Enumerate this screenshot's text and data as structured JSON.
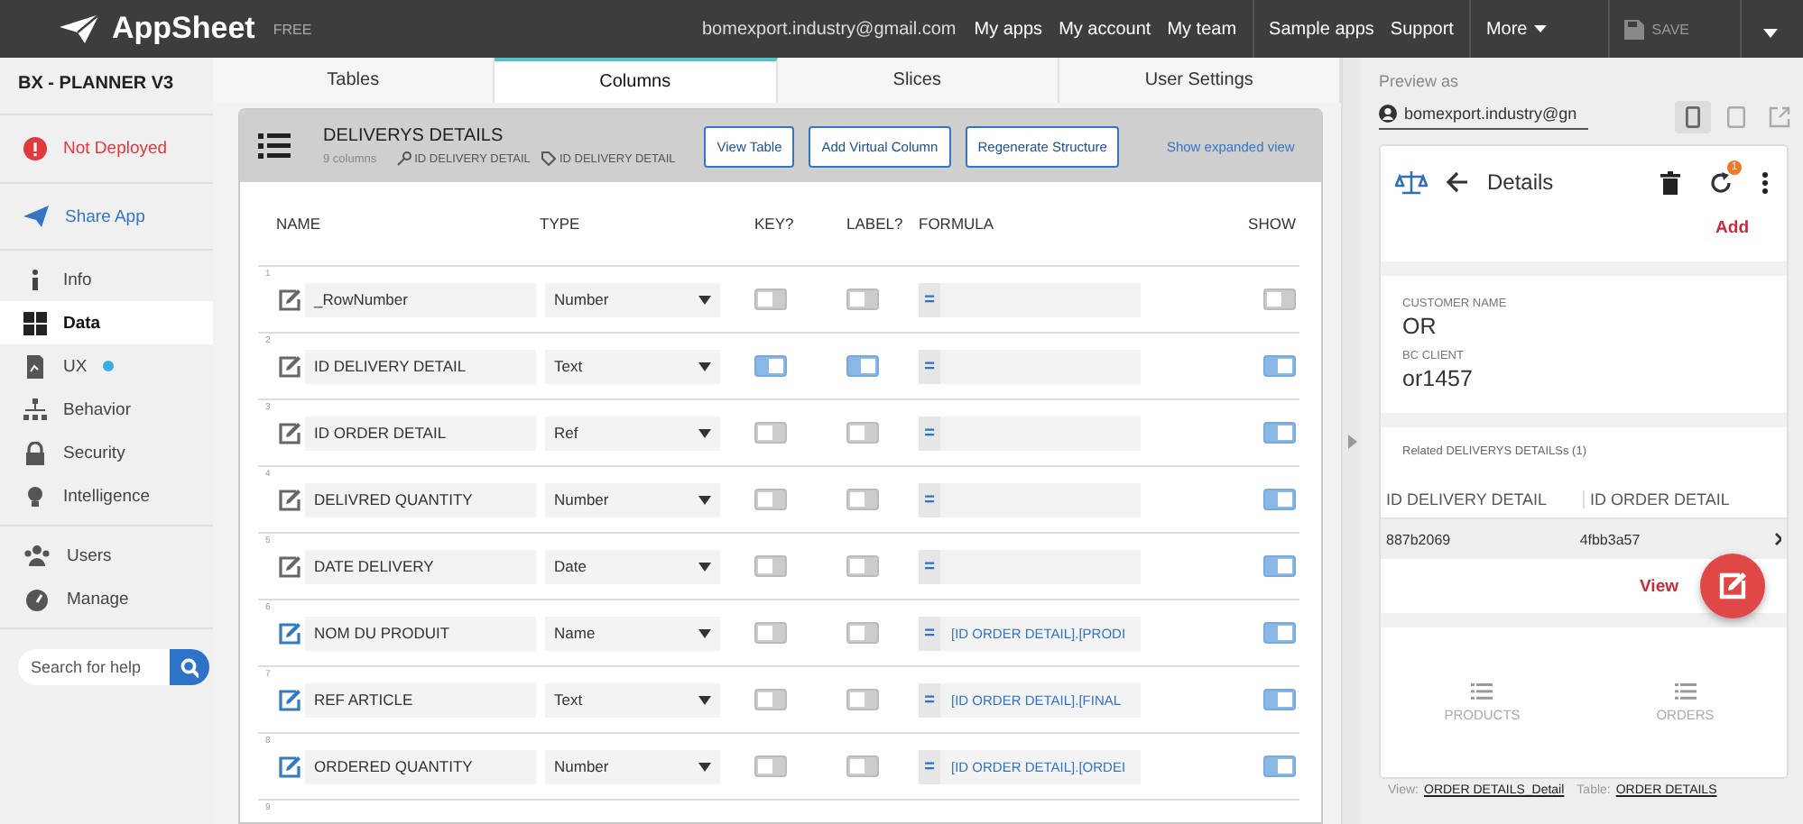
{
  "topbar": {
    "brand": "AppSheet",
    "plan": "FREE",
    "email": "bomexport.industry@gmail.com",
    "links": [
      "My apps",
      "My account",
      "My team",
      "Sample apps",
      "Support"
    ],
    "more": "More",
    "save": "SAVE"
  },
  "sidebar": {
    "app_name": "BX - PLANNER V3",
    "status": "Not Deployed",
    "share": "Share App",
    "items": [
      {
        "label": "Info",
        "kind": "info",
        "selected": false,
        "dot": false
      },
      {
        "label": "Data",
        "kind": "data",
        "selected": true,
        "dot": false
      },
      {
        "label": "UX",
        "kind": "ux",
        "selected": false,
        "dot": true
      },
      {
        "label": "Behavior",
        "kind": "behavior",
        "selected": false,
        "dot": false
      },
      {
        "label": "Security",
        "kind": "security",
        "selected": false,
        "dot": false
      },
      {
        "label": "Intelligence",
        "kind": "intelligence",
        "selected": false,
        "dot": false
      }
    ],
    "admin_items": [
      {
        "label": "Users",
        "kind": "users"
      },
      {
        "label": "Manage",
        "kind": "manage"
      }
    ],
    "search": {
      "placeholder": "Search for help"
    }
  },
  "tabs": [
    {
      "label": "Tables",
      "selected": false
    },
    {
      "label": "Columns",
      "selected": true
    },
    {
      "label": "Slices",
      "selected": false
    },
    {
      "label": "User Settings",
      "selected": false
    }
  ],
  "table_card": {
    "title": "DELIVERYS DETAILS",
    "count": "9 columns",
    "key": "ID DELIVERY DETAIL",
    "label": "ID DELIVERY DETAIL",
    "buttons": [
      "View Table",
      "Add Virtual Column",
      "Regenerate Structure"
    ],
    "expand_link": "Show expanded view",
    "columns": [
      "NAME",
      "TYPE",
      "KEY?",
      "LABEL?",
      "FORMULA",
      "SHOW"
    ],
    "rows": [
      {
        "index": "1",
        "name": "_RowNumber",
        "type": "Number",
        "key": false,
        "label": false,
        "formula": "",
        "show": false,
        "virtual": false
      },
      {
        "index": "2",
        "name": "ID DELIVERY DETAIL",
        "type": "Text",
        "key": true,
        "label": true,
        "formula": "",
        "show": true,
        "virtual": false
      },
      {
        "index": "3",
        "name": "ID ORDER DETAIL",
        "type": "Ref",
        "key": false,
        "label": false,
        "formula": "",
        "show": true,
        "virtual": false
      },
      {
        "index": "4",
        "name": "DELIVRED QUANTITY",
        "type": "Number",
        "key": false,
        "label": false,
        "formula": "",
        "show": true,
        "virtual": false
      },
      {
        "index": "5",
        "name": "DATE DELIVERY",
        "type": "Date",
        "key": false,
        "label": false,
        "formula": "",
        "show": true,
        "virtual": false
      },
      {
        "index": "6",
        "name": "NOM DU PRODUIT",
        "type": "Name",
        "key": false,
        "label": false,
        "formula": "[ID ORDER DETAIL].[PRODI",
        "show": true,
        "virtual": true
      },
      {
        "index": "7",
        "name": "REF ARTICLE",
        "type": "Text",
        "key": false,
        "label": false,
        "formula": "[ID ORDER DETAIL].[FINAL",
        "show": true,
        "virtual": true
      },
      {
        "index": "8",
        "name": "ORDERED QUANTITY",
        "type": "Number",
        "key": false,
        "label": false,
        "formula": "[ID ORDER DETAIL].[ORDEI",
        "show": true,
        "virtual": true
      }
    ],
    "partial_row_index": "9",
    "equals": "="
  },
  "preview": {
    "heading": "Preview as",
    "user": "bomexport.industry@gn",
    "title": "Details",
    "badge": "1",
    "add": "Add",
    "fields": [
      {
        "label": "CUSTOMER NAME",
        "value": "OR"
      },
      {
        "label": "BC CLIENT",
        "value": "or1457"
      }
    ],
    "related": "Related DELIVERYS DETAILSs (1)",
    "related_columns": [
      "ID DELIVERY DETAIL",
      "ID ORDER DETAIL"
    ],
    "related_row": [
      "887b2069",
      "4fbb3a57"
    ],
    "view": "View",
    "nav": [
      "PRODUCTS",
      "ORDERS"
    ],
    "footer": {
      "view_label": "View:",
      "view": "ORDER DETAILS_Detail",
      "table_label": "Table:",
      "table": "ORDER DETAILS"
    }
  }
}
